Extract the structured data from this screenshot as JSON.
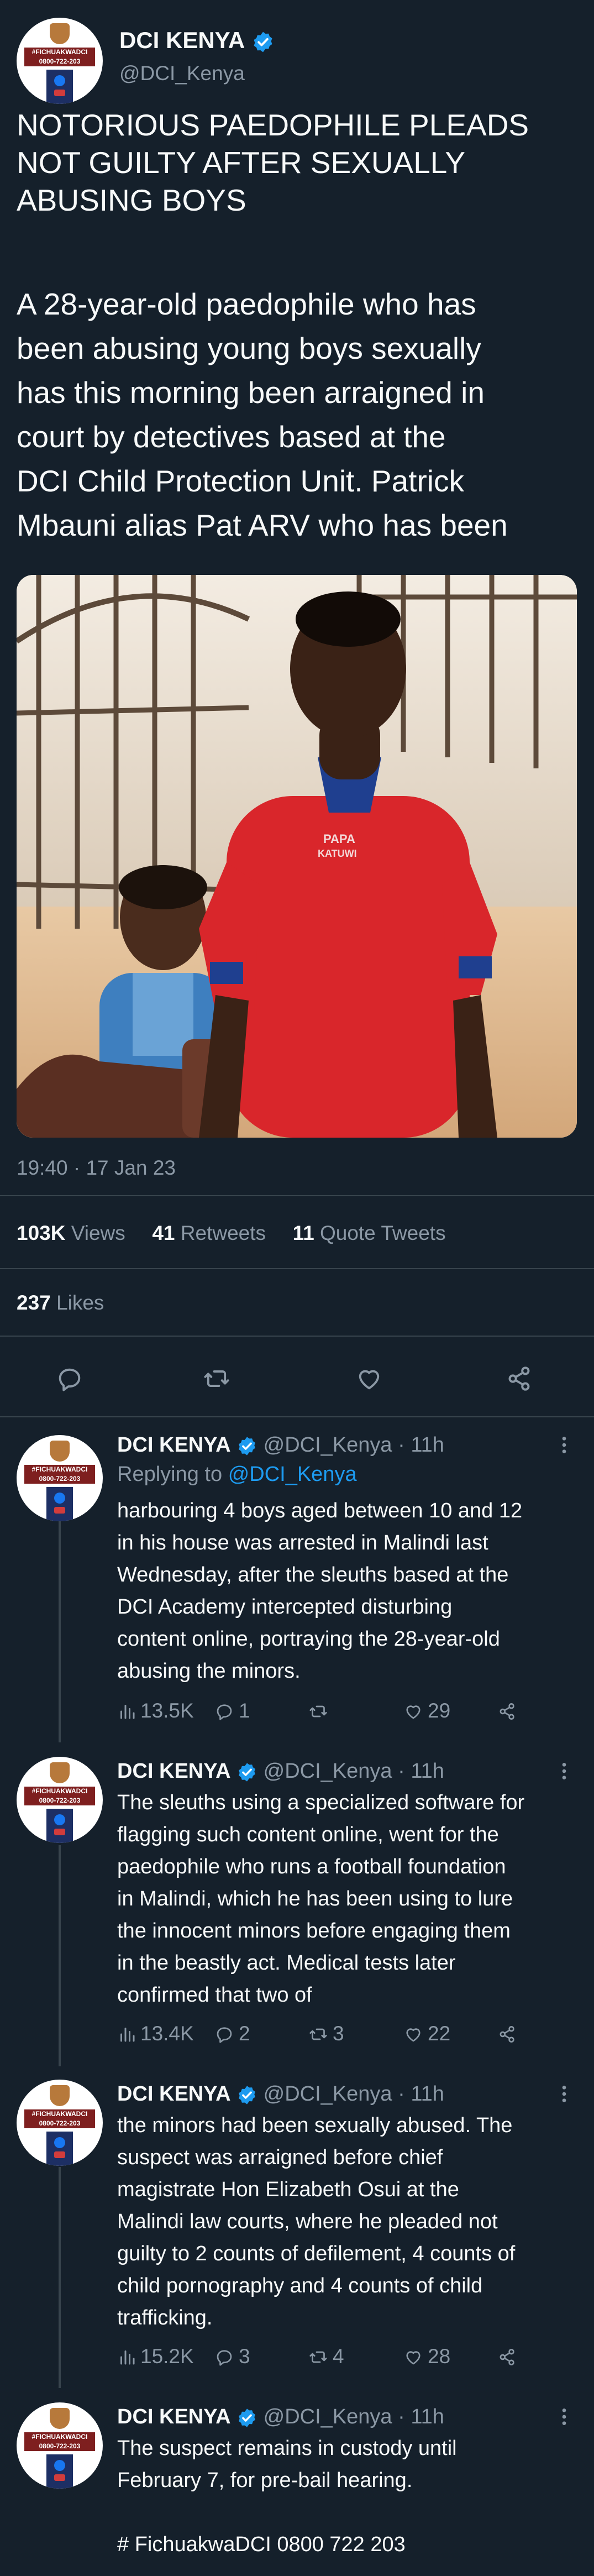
{
  "main": {
    "account_name": "DCI KENYA",
    "handle": "@DCI_Kenya",
    "headline_lines": [
      "NOTORIOUS PAEDOPHILE PLEADS",
      "NOT GUILTY AFTER SEXUALLY",
      "ABUSING BOYS"
    ],
    "body_lines": [
      "A 28-year-old paedophile who has",
      "been abusing young boys sexually",
      "has this morning been arraigned in",
      "court by detectives based at the",
      "DCI Child Protection Unit. Patrick",
      "Mbauni alias Pat ARV who has been"
    ],
    "timestamp": "19:40 · 17 Jan 23",
    "views_count": "103K",
    "views_label": "Views",
    "retweets_count": "41",
    "retweets_label": "Retweets",
    "quotes_count": "11",
    "quotes_label": "Quote Tweets",
    "likes_count": "237",
    "likes_label": "Likes",
    "photo_shirt_text": "PAPA\nKATUWI"
  },
  "avatar": {
    "tag_text": "#FICHUAKWADCI\n0800-722-203"
  },
  "replies": [
    {
      "name": "DCI KENYA",
      "handle": "@DCI_Kenya",
      "time": "· 11h",
      "replying_label": "Replying to",
      "replying_handle": "@DCI_Kenya",
      "lines": [
        "harbouring 4 boys aged between 10 and 12",
        "in his house was arrested in Malindi last",
        "Wednesday, after the sleuths based at the",
        "DCI Academy intercepted disturbing",
        "content online, portraying the 28-year-old",
        "abusing the minors."
      ],
      "views": "13.5K",
      "comments": "1",
      "retweets": "",
      "likes": "29"
    },
    {
      "name": "DCI KENYA",
      "handle": "@DCI_Kenya",
      "time": "· 11h",
      "lines": [
        "The sleuths using a specialized software for",
        "flagging such content online, went for the",
        "paedophile who runs a football foundation",
        "in Malindi, which he has been using to lure",
        "the innocent minors before engaging them",
        "in the beastly act. Medical tests later",
        "confirmed that two of"
      ],
      "views": "13.4K",
      "comments": "2",
      "retweets": "3",
      "likes": "22"
    },
    {
      "name": "DCI KENYA",
      "handle": "@DCI_Kenya",
      "time": "· 11h",
      "lines": [
        "the minors had been sexually abused. The",
        "suspect was arraigned before chief",
        "magistrate Hon Elizabeth Osui at the",
        "Malindi law courts, where he pleaded not",
        "guilty to 2 counts of defilement, 4 counts of",
        "child pornography and 4 counts of child",
        "trafficking."
      ],
      "views": "15.2K",
      "comments": "3",
      "retweets": "4",
      "likes": "28"
    },
    {
      "name": "DCI KENYA",
      "handle": "@DCI_Kenya",
      "time": "· 11h",
      "lines": [
        "The suspect remains in custody until",
        "February 7, for pre-bail hearing.",
        "",
        "# FichuakwaDCI 0800 722 203"
      ]
    }
  ],
  "icons": {
    "verified": "verified-badge-icon",
    "reply": "reply-icon",
    "retweet": "retweet-icon",
    "like": "heart-icon",
    "share": "share-icon",
    "views": "views-bar-icon",
    "more": "more-dots-icon"
  },
  "colors": {
    "background": "#15202b",
    "text": "#f7f9f9",
    "muted": "#8b98a5",
    "accent": "#1d9bf0",
    "divider": "#38444d"
  }
}
